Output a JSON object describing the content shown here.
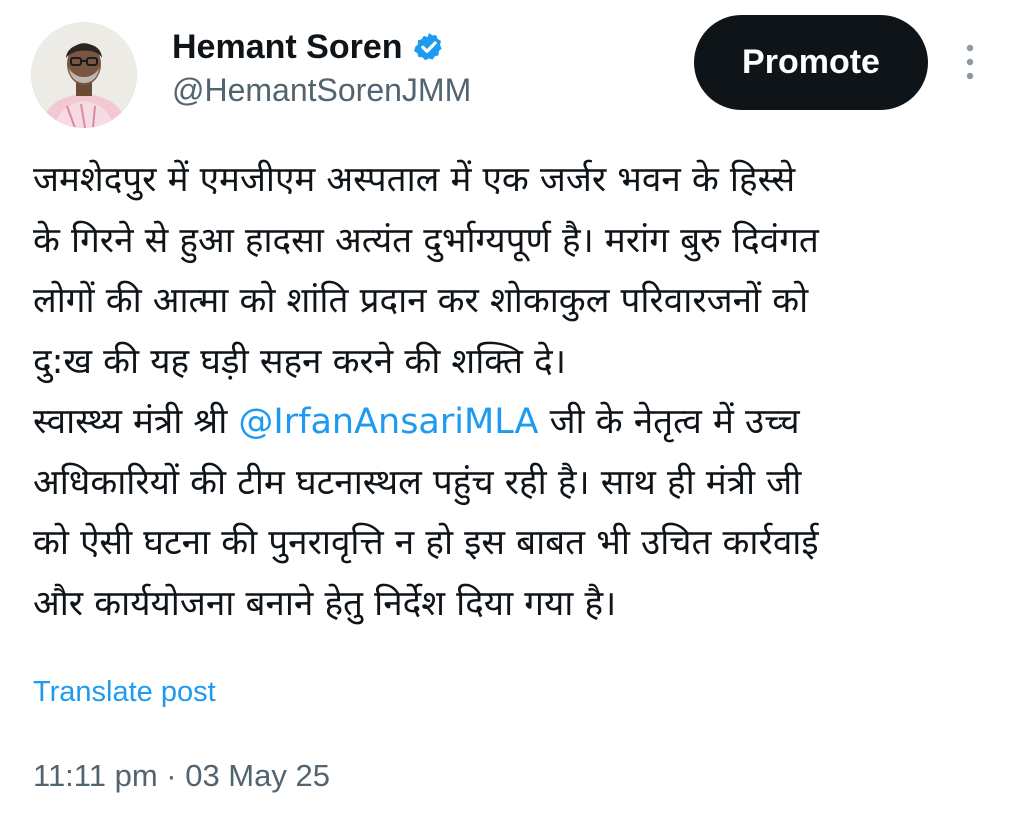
{
  "author": {
    "display_name": "Hemant Soren",
    "handle": "@HemantSorenJMM",
    "verified": true,
    "avatar_icon": "profile-photo"
  },
  "actions": {
    "promote_label": "Promote",
    "more_icon": "vertical-ellipsis-icon"
  },
  "post": {
    "lines": [
      "जमशेदपुर में एमजीएम अस्पताल में एक जर्जर भवन के हिस्से",
      "के गिरने से हुआ हादसा अत्यंत दुर्भाग्यपूर्ण है। मरांग बुरु दिवंगत",
      "लोगों की आत्मा को शांति प्रदान कर शोकाकुल परिवारजनों को",
      "दु:ख की यह घड़ी सहन करने की शक्ति दे।"
    ],
    "line5_before": "स्वास्थ्य मंत्री श्री ",
    "mention": "@IrfanAnsariMLA",
    "line5_after": " जी के नेतृत्व में उच्च",
    "lines_after": [
      "अधिकारियों की टीम घटनास्थल पहुंच रही है। साथ ही मंत्री जी",
      "को ऐसी घटना की पुनरावृत्ति न हो इस बाबत भी उचित कार्रवाई",
      "और कार्ययोजना बनाने हेतु निर्देश दिया गया है।"
    ],
    "translate_label": "Translate post",
    "timestamp": "11:11 pm · 03 May 25"
  },
  "colors": {
    "accent": "#1d9bf0",
    "text": "#0f1419",
    "muted": "#536471",
    "button_bg": "#0f1419"
  }
}
